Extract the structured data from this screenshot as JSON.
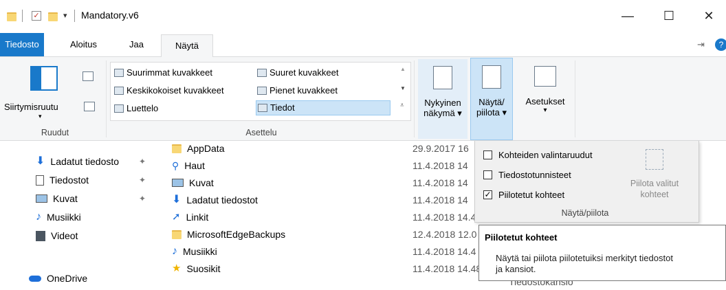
{
  "window": {
    "title": "Mandatory.v6",
    "minimize": "—",
    "maximize": "☐",
    "close": "✕"
  },
  "tabs": [
    {
      "label": "Tiedosto"
    },
    {
      "label": "Aloitus"
    },
    {
      "label": "Jaa"
    },
    {
      "label": "Näytä"
    }
  ],
  "ribbon": {
    "panes": {
      "navigation_pane_label": "Siirtymisruutu",
      "group_label": "Ruudut"
    },
    "layout": {
      "group_label": "Asettelu",
      "items": [
        {
          "label": "Suurimmat kuvakkeet"
        },
        {
          "label": "Suuret kuvakkeet"
        },
        {
          "label": "Keskikokoiset kuvakkeet"
        },
        {
          "label": "Pienet kuvakkeet"
        },
        {
          "label": "Luettelo"
        },
        {
          "label": "Tiedot",
          "selected": true
        }
      ]
    },
    "current_view": {
      "line1": "Nykyinen",
      "line2": "näkymä ▾"
    },
    "show_hide": {
      "line1": "Näytä/",
      "line2": "piilota ▾"
    },
    "options": {
      "label": "Asetukset",
      "arrow": "▾"
    }
  },
  "dropdown": {
    "items": [
      {
        "label": "Kohteiden valintaruudut",
        "checked": false
      },
      {
        "label": "Tiedostotunnisteet",
        "checked": false
      },
      {
        "label": "Piilotetut kohteet",
        "checked": true
      }
    ],
    "hide_selected_line1": "Piilota valitut",
    "hide_selected_line2": "kohteet",
    "group_label": "Näytä/piilota"
  },
  "tooltip": {
    "title": "Piilotetut kohteet",
    "body_line1": "Näytä tai piilota piilotetuiksi merkityt tiedostot",
    "body_line2": "ja kansiot."
  },
  "nav": {
    "items": [
      {
        "label": "Ladatut tiedosto",
        "icon": "download-icon",
        "pinned": true
      },
      {
        "label": "Tiedostot",
        "icon": "document-icon",
        "pinned": true
      },
      {
        "label": "Kuvat",
        "icon": "pictures-icon",
        "pinned": true
      },
      {
        "label": "Musiikki",
        "icon": "music-icon",
        "pinned": false
      },
      {
        "label": "Videot",
        "icon": "video-icon",
        "pinned": false
      },
      {
        "label": "OneDrive",
        "icon": "cloud-icon",
        "pinned": false
      }
    ]
  },
  "files": {
    "rows": [
      {
        "name": "AppData",
        "icon": "folder-icon",
        "date": "29.9.2017 16"
      },
      {
        "name": "Haut",
        "icon": "search-icon",
        "date": "11.4.2018 14"
      },
      {
        "name": "Kuvat",
        "icon": "pictures-icon",
        "date": "11.4.2018 14"
      },
      {
        "name": "Ladatut tiedostot",
        "icon": "download-icon",
        "date": "11.4.2018 14"
      },
      {
        "name": "Linkit",
        "icon": "link-icon",
        "date": "11.4.2018 14.4"
      },
      {
        "name": "MicrosoftEdgeBackups",
        "icon": "folder-icon",
        "date": "12.4.2018 12.0"
      },
      {
        "name": "Musiikki",
        "icon": "music-icon",
        "date": "11.4.2018 14.4"
      },
      {
        "name": "Suosikit",
        "icon": "star-icon",
        "date": "11.4.2018 14.48",
        "type": "Tiedostokansio"
      }
    ]
  },
  "colors": {
    "accent": "#1979ca",
    "selected_bg": "#cce4f7",
    "ribbon_bg": "#f5f6f7"
  }
}
